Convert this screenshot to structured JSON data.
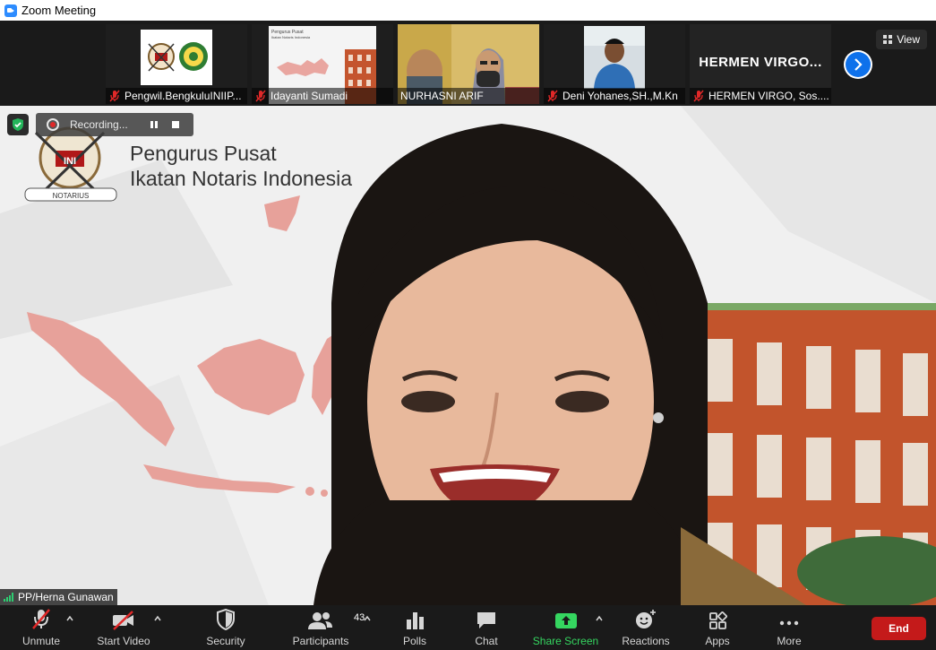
{
  "window": {
    "title": "Zoom Meeting"
  },
  "strip": {
    "view_label": "View",
    "tiles": [
      {
        "name": "Pengwil.BengkuluINIIP..."
      },
      {
        "name": "Idayanti Sumadi",
        "slide_title": "Pengurus Pusat",
        "slide_sub": "Ikatan Notaris Indonesia"
      },
      {
        "name": "NURHASNI ARIF"
      },
      {
        "name": "Deni Yohanes,SH.,M.Kn"
      },
      {
        "name": "HERMEN VIRGO, Sos....",
        "big_name": "HERMEN  VIRGO..."
      }
    ]
  },
  "main": {
    "org_line1": "Pengurus Pusat",
    "org_line2": "Ikatan Notaris Indonesia",
    "logo_text": "INI",
    "logo_ribbon": "NOTARIUS",
    "recording_label": "Recording...",
    "speaker_name": "PP/Herna Gunawan"
  },
  "toolbar": {
    "unmute": "Unmute",
    "start_video": "Start Video",
    "security": "Security",
    "participants": "Participants",
    "participants_count": "43",
    "polls": "Polls",
    "chat": "Chat",
    "share_screen": "Share Screen",
    "reactions": "Reactions",
    "apps": "Apps",
    "more": "More",
    "end": "End"
  },
  "colors": {
    "accent_blue": "#0e71eb",
    "share_green": "#35d660",
    "end_red": "#c41a1a",
    "muted_red": "#e02828"
  }
}
